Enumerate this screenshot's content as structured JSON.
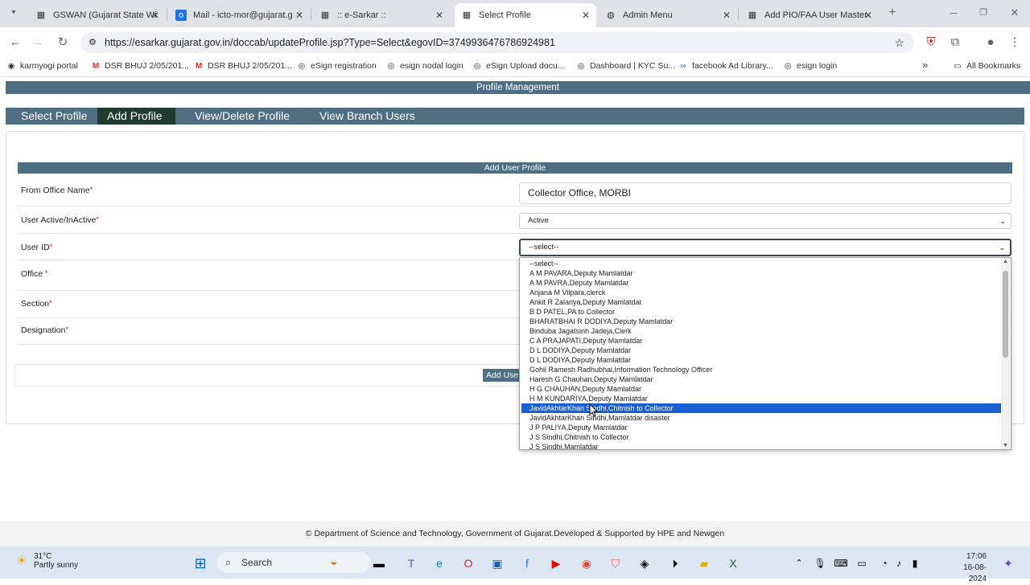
{
  "browser": {
    "tabs": [
      {
        "title": "GSWAN (Gujarat State Wi",
        "icon": "page-icon"
      },
      {
        "title": "Mail - icto-mor@gujarat.g",
        "icon": "outlook-icon"
      },
      {
        "title": ":: e-Sarkar ::",
        "icon": "page-icon"
      },
      {
        "title": "Select Profile",
        "icon": "page-icon"
      },
      {
        "title": "Admin Menu",
        "icon": "globe-icon"
      },
      {
        "title": "Add PIO/FAA User Master",
        "icon": "page-icon"
      }
    ],
    "url": "https://esarkar.gujarat.gov.in/doccab/updateProfile.jsp?Type=Select&egovID=3749936476786924981",
    "bookmarks": [
      "karmyogi portal",
      "DSR BHUJ 2/05/201...",
      "DSR BHUJ 2/05/201...",
      "eSign registration",
      "esign nodal login",
      "eSign Upload docu...",
      "Dashboard | KYC Su...",
      "facebook Ad Library...",
      "esign login"
    ],
    "all_bookmarks": "All Bookmarks"
  },
  "page": {
    "header": "Profile Management",
    "menu": [
      "Select Profile",
      "Add Profile",
      "View/Delete Profile",
      "View Branch Users"
    ],
    "form_title": "Add User Profile",
    "labels": {
      "from_office": "From Office Name",
      "user_active": "User Active/InActive",
      "user_id": "User ID",
      "office": "Office",
      "section": "Section",
      "designation": "Designation"
    },
    "from_office_value": "Collector Office, MORBI",
    "user_active_value": "Active",
    "user_id_value": "--select--",
    "add_button": "Add User",
    "dropdown_options": [
      "--select--",
      "A M PAVARA,Deputy Mamlatdar",
      "A M PAVRA,Deputy Mamlatdar",
      "Anjana M Vilpara,clerck",
      "Ankit R Zalariya,Deputy Mamlatdar",
      "B D PATEL,PA to Collector",
      "BHARATBHAI R DODIYA,Deputy Mamlatdar",
      "Binduba Jagatsinh Jadeja,Clerk",
      "C A PRAJAPATI,Deputy Mamlatdar",
      "D L DODIYA,Deputy Mamlatdar",
      "D L DODIYA,Deputy Mamlatdar",
      "Gohil Ramesh Radhubhai,Information Technology Officer",
      "Haresh G Chauhan,Deputy Mamlatdar",
      "H G CHAUHAN,Deputy Mamlatdar",
      "H M KUNDARIYA,Deputy Mamlatdar",
      "JavidAkhtarKhan Sindhi,Chitnish to Collector",
      "JavidAkhtarKhan Sindhi,Mamlatdar disaster",
      "J P PALIYA,Deputy Mamlatdar",
      "J S Sindhi,Chitnish to Collector",
      "J S Sindhi,Mamlatdar"
    ],
    "highlighted_option": "JavidAkhtarKhan Sindhi,Chitnish to Collector",
    "footer": "© Department of Science and Technology, Government of Gujarat.Developed & Supported by HPE and Newgen"
  },
  "taskbar": {
    "temperature": "31°C",
    "weather": "Partly sunny",
    "search": "Search",
    "time": "17:06",
    "date": "16-08-2024"
  }
}
